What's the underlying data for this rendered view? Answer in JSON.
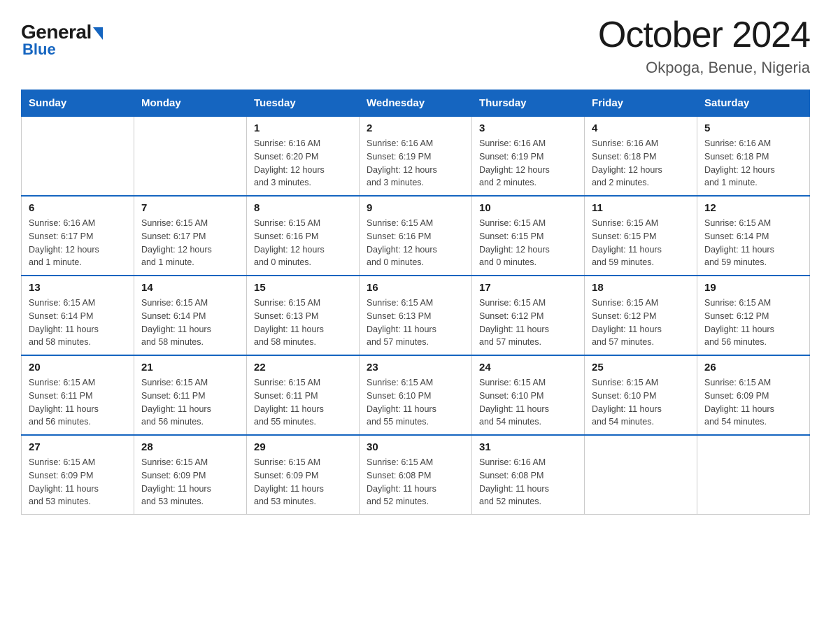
{
  "header": {
    "logo_general": "General",
    "logo_blue": "Blue",
    "title": "October 2024",
    "subtitle": "Okpoga, Benue, Nigeria"
  },
  "days_of_week": [
    "Sunday",
    "Monday",
    "Tuesday",
    "Wednesday",
    "Thursday",
    "Friday",
    "Saturday"
  ],
  "weeks": [
    [
      {
        "day": "",
        "info": ""
      },
      {
        "day": "",
        "info": ""
      },
      {
        "day": "1",
        "info": "Sunrise: 6:16 AM\nSunset: 6:20 PM\nDaylight: 12 hours\nand 3 minutes."
      },
      {
        "day": "2",
        "info": "Sunrise: 6:16 AM\nSunset: 6:19 PM\nDaylight: 12 hours\nand 3 minutes."
      },
      {
        "day": "3",
        "info": "Sunrise: 6:16 AM\nSunset: 6:19 PM\nDaylight: 12 hours\nand 2 minutes."
      },
      {
        "day": "4",
        "info": "Sunrise: 6:16 AM\nSunset: 6:18 PM\nDaylight: 12 hours\nand 2 minutes."
      },
      {
        "day": "5",
        "info": "Sunrise: 6:16 AM\nSunset: 6:18 PM\nDaylight: 12 hours\nand 1 minute."
      }
    ],
    [
      {
        "day": "6",
        "info": "Sunrise: 6:16 AM\nSunset: 6:17 PM\nDaylight: 12 hours\nand 1 minute."
      },
      {
        "day": "7",
        "info": "Sunrise: 6:15 AM\nSunset: 6:17 PM\nDaylight: 12 hours\nand 1 minute."
      },
      {
        "day": "8",
        "info": "Sunrise: 6:15 AM\nSunset: 6:16 PM\nDaylight: 12 hours\nand 0 minutes."
      },
      {
        "day": "9",
        "info": "Sunrise: 6:15 AM\nSunset: 6:16 PM\nDaylight: 12 hours\nand 0 minutes."
      },
      {
        "day": "10",
        "info": "Sunrise: 6:15 AM\nSunset: 6:15 PM\nDaylight: 12 hours\nand 0 minutes."
      },
      {
        "day": "11",
        "info": "Sunrise: 6:15 AM\nSunset: 6:15 PM\nDaylight: 11 hours\nand 59 minutes."
      },
      {
        "day": "12",
        "info": "Sunrise: 6:15 AM\nSunset: 6:14 PM\nDaylight: 11 hours\nand 59 minutes."
      }
    ],
    [
      {
        "day": "13",
        "info": "Sunrise: 6:15 AM\nSunset: 6:14 PM\nDaylight: 11 hours\nand 58 minutes."
      },
      {
        "day": "14",
        "info": "Sunrise: 6:15 AM\nSunset: 6:14 PM\nDaylight: 11 hours\nand 58 minutes."
      },
      {
        "day": "15",
        "info": "Sunrise: 6:15 AM\nSunset: 6:13 PM\nDaylight: 11 hours\nand 58 minutes."
      },
      {
        "day": "16",
        "info": "Sunrise: 6:15 AM\nSunset: 6:13 PM\nDaylight: 11 hours\nand 57 minutes."
      },
      {
        "day": "17",
        "info": "Sunrise: 6:15 AM\nSunset: 6:12 PM\nDaylight: 11 hours\nand 57 minutes."
      },
      {
        "day": "18",
        "info": "Sunrise: 6:15 AM\nSunset: 6:12 PM\nDaylight: 11 hours\nand 57 minutes."
      },
      {
        "day": "19",
        "info": "Sunrise: 6:15 AM\nSunset: 6:12 PM\nDaylight: 11 hours\nand 56 minutes."
      }
    ],
    [
      {
        "day": "20",
        "info": "Sunrise: 6:15 AM\nSunset: 6:11 PM\nDaylight: 11 hours\nand 56 minutes."
      },
      {
        "day": "21",
        "info": "Sunrise: 6:15 AM\nSunset: 6:11 PM\nDaylight: 11 hours\nand 56 minutes."
      },
      {
        "day": "22",
        "info": "Sunrise: 6:15 AM\nSunset: 6:11 PM\nDaylight: 11 hours\nand 55 minutes."
      },
      {
        "day": "23",
        "info": "Sunrise: 6:15 AM\nSunset: 6:10 PM\nDaylight: 11 hours\nand 55 minutes."
      },
      {
        "day": "24",
        "info": "Sunrise: 6:15 AM\nSunset: 6:10 PM\nDaylight: 11 hours\nand 54 minutes."
      },
      {
        "day": "25",
        "info": "Sunrise: 6:15 AM\nSunset: 6:10 PM\nDaylight: 11 hours\nand 54 minutes."
      },
      {
        "day": "26",
        "info": "Sunrise: 6:15 AM\nSunset: 6:09 PM\nDaylight: 11 hours\nand 54 minutes."
      }
    ],
    [
      {
        "day": "27",
        "info": "Sunrise: 6:15 AM\nSunset: 6:09 PM\nDaylight: 11 hours\nand 53 minutes."
      },
      {
        "day": "28",
        "info": "Sunrise: 6:15 AM\nSunset: 6:09 PM\nDaylight: 11 hours\nand 53 minutes."
      },
      {
        "day": "29",
        "info": "Sunrise: 6:15 AM\nSunset: 6:09 PM\nDaylight: 11 hours\nand 53 minutes."
      },
      {
        "day": "30",
        "info": "Sunrise: 6:15 AM\nSunset: 6:08 PM\nDaylight: 11 hours\nand 52 minutes."
      },
      {
        "day": "31",
        "info": "Sunrise: 6:16 AM\nSunset: 6:08 PM\nDaylight: 11 hours\nand 52 minutes."
      },
      {
        "day": "",
        "info": ""
      },
      {
        "day": "",
        "info": ""
      }
    ]
  ]
}
